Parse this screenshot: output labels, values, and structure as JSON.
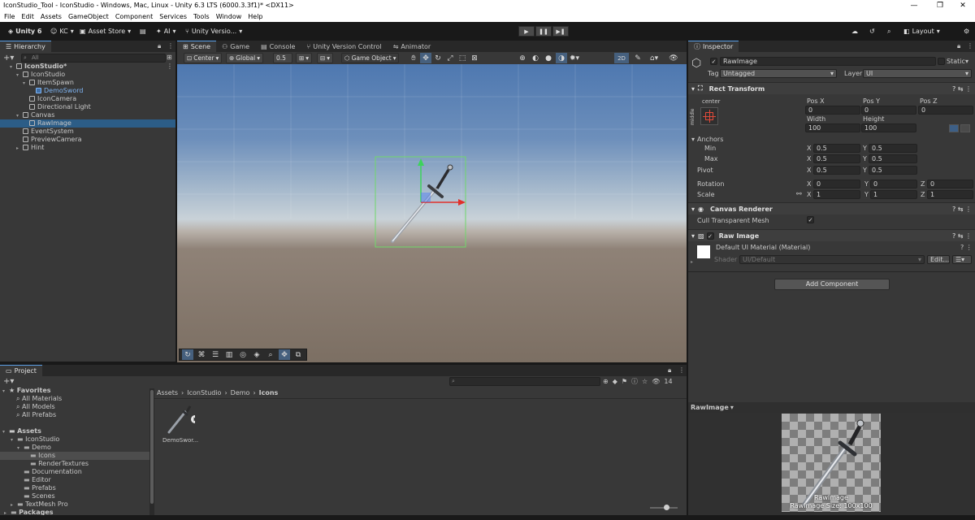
{
  "window": {
    "title": "IconStudio_Tool - IconStudio - Windows, Mac, Linux - Unity 6.3 LTS (6000.3.3f1)* <DX11>",
    "minimize": "—",
    "maximize": "❐",
    "close": "✕"
  },
  "menu": [
    "File",
    "Edit",
    "Assets",
    "GameObject",
    "Component",
    "Services",
    "Tools",
    "Window",
    "Help"
  ],
  "toolbar": {
    "account": "Unity 6",
    "user": "KC",
    "asset_store": "Asset Store",
    "ai": "AI",
    "version_control": "Unity Versio...",
    "layout": "Layout",
    "play": "▶",
    "pause": "❚❚",
    "step": "▶❚"
  },
  "hierarchy": {
    "tab": "Hierarchy",
    "search_placeholder": "All",
    "items": [
      {
        "label": "IconStudio*",
        "depth": 0
      },
      {
        "label": "IconStudio",
        "depth": 1
      },
      {
        "label": "ItemSpawn",
        "depth": 2
      },
      {
        "label": "DemoSword",
        "depth": 3
      },
      {
        "label": "IconCamera",
        "depth": 2
      },
      {
        "label": "Directional Light",
        "depth": 2
      },
      {
        "label": "Canvas",
        "depth": 1
      },
      {
        "label": "RawImage",
        "depth": 2
      },
      {
        "label": "EventSystem",
        "depth": 1
      },
      {
        "label": "PreviewCamera",
        "depth": 1
      },
      {
        "label": "Hint",
        "depth": 1
      }
    ]
  },
  "center_tabs": [
    "Scene",
    "Game",
    "Console",
    "Unity Version Control",
    "Animator"
  ],
  "scene_toolbar": {
    "pivot": "Center",
    "space": "Global",
    "snap": "0.5",
    "game_object": "Game Object",
    "mode_2d": "2D"
  },
  "inspector": {
    "tab": "Inspector",
    "object_name": "RawImage",
    "static_label": "Static",
    "tag_label": "Tag",
    "tag_value": "Untagged",
    "layer_label": "Layer",
    "layer_value": "UI",
    "rect_transform": {
      "title": "Rect Transform",
      "anchor_preset_top": "center",
      "anchor_preset_side": "middle",
      "pos_x_label": "Pos X",
      "pos_y_label": "Pos Y",
      "pos_z_label": "Pos Z",
      "pos_x": "0",
      "pos_y": "0",
      "pos_z": "0",
      "width_label": "Width",
      "height_label": "Height",
      "width": "100",
      "height": "100",
      "anchors_label": "Anchors",
      "min_label": "Min",
      "max_label": "Max",
      "min_x": "0.5",
      "min_y": "0.5",
      "max_x": "0.5",
      "max_y": "0.5",
      "pivot_label": "Pivot",
      "pivot_x": "0.5",
      "pivot_y": "0.5",
      "rotation_label": "Rotation",
      "rot_x": "0",
      "rot_y": "0",
      "rot_z": "0",
      "scale_label": "Scale",
      "scale_x": "1",
      "scale_y": "1",
      "scale_z": "1"
    },
    "canvas_renderer": {
      "title": "Canvas Renderer",
      "cull_label": "Cull Transparent Mesh"
    },
    "raw_image": {
      "title": "Raw Image",
      "material_name": "Default UI Material (Material)",
      "shader_label": "Shader",
      "shader_value": "UI/Default",
      "edit_button": "Edit..."
    },
    "add_component": "Add Component"
  },
  "preview": {
    "title": "RawImage",
    "caption_name": "RawImage",
    "caption_size": "RawImage Size: 100x100"
  },
  "project": {
    "tab": "Project",
    "favorites": {
      "label": "Favorites",
      "items": [
        "All Materials",
        "All Models",
        "All Prefabs"
      ]
    },
    "assets": {
      "label": "Assets",
      "tree": [
        {
          "label": "IconStudio",
          "depth": 1
        },
        {
          "label": "Demo",
          "depth": 2
        },
        {
          "label": "Icons",
          "depth": 3
        },
        {
          "label": "RenderTextures",
          "depth": 3
        },
        {
          "label": "Documentation",
          "depth": 2
        },
        {
          "label": "Editor",
          "depth": 2
        },
        {
          "label": "Prefabs",
          "depth": 2
        },
        {
          "label": "Scenes",
          "depth": 2
        },
        {
          "label": "TextMesh Pro",
          "depth": 1
        },
        {
          "label": "Packages",
          "depth": 0
        }
      ]
    },
    "breadcrumb": [
      "Assets",
      "IconStudio",
      "Demo",
      "Icons"
    ],
    "hidden_count": "14",
    "files": [
      {
        "label": "DemoSwor..."
      }
    ]
  },
  "colors": {
    "selection": "#2c5d87",
    "accent": "#5a9ee6",
    "gizmo_x": "#e0302a",
    "gizmo_y": "#3cd35b",
    "rect_outline": "#6fd86a"
  }
}
